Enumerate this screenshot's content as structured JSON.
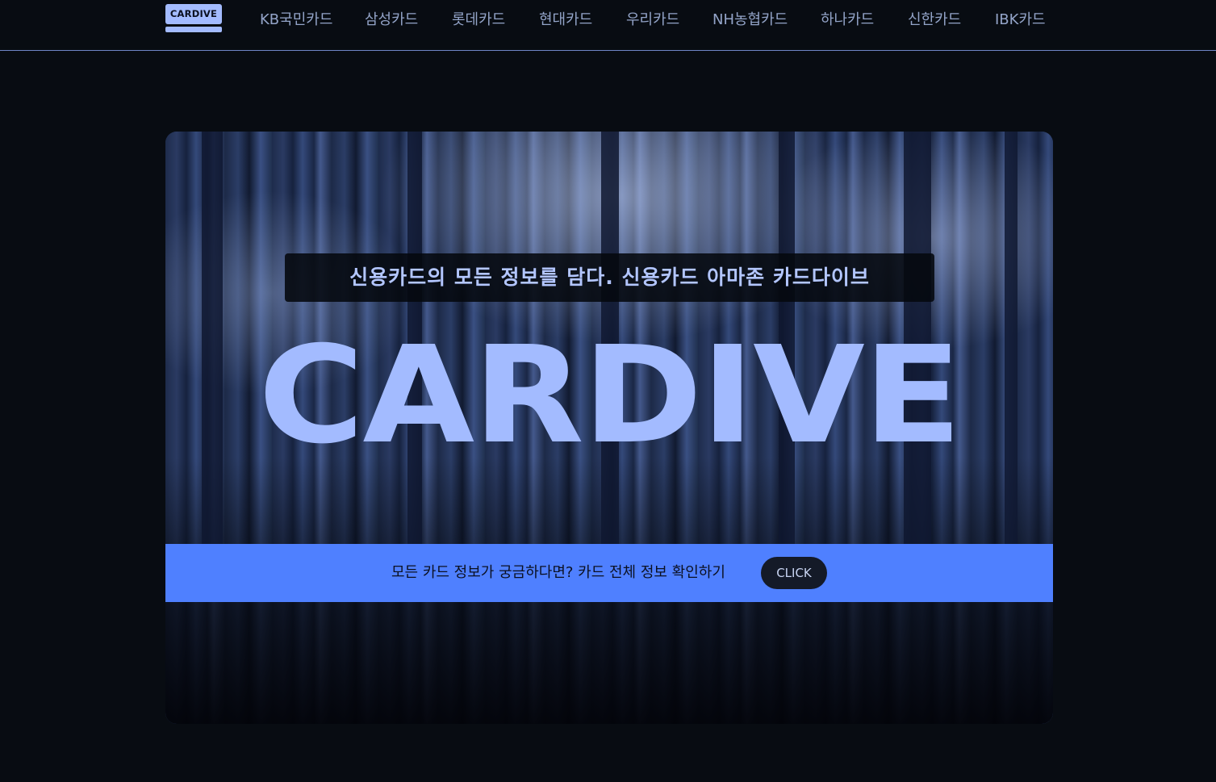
{
  "header": {
    "logo_text": "CARDIVE",
    "nav_items": [
      {
        "label": "KB국민카드"
      },
      {
        "label": "삼성카드"
      },
      {
        "label": "롯데카드"
      },
      {
        "label": "현대카드"
      },
      {
        "label": "우리카드"
      },
      {
        "label": "NH농협카드"
      },
      {
        "label": "하나카드"
      },
      {
        "label": "신한카드"
      },
      {
        "label": "IBK카드"
      }
    ]
  },
  "hero": {
    "tagline": "신용카드의 모든 정보를 담다. 신용카드 아마존 카드다이브",
    "title": "CARDIVE",
    "cta_text": "모든 카드 정보가 궁금하다면? 카드 전체 정보 확인하기",
    "cta_button": "CLICK"
  },
  "colors": {
    "background": "#080c12",
    "accent": "#a3bbff",
    "cta_band": "#4f80ff",
    "button": "#141a28"
  }
}
